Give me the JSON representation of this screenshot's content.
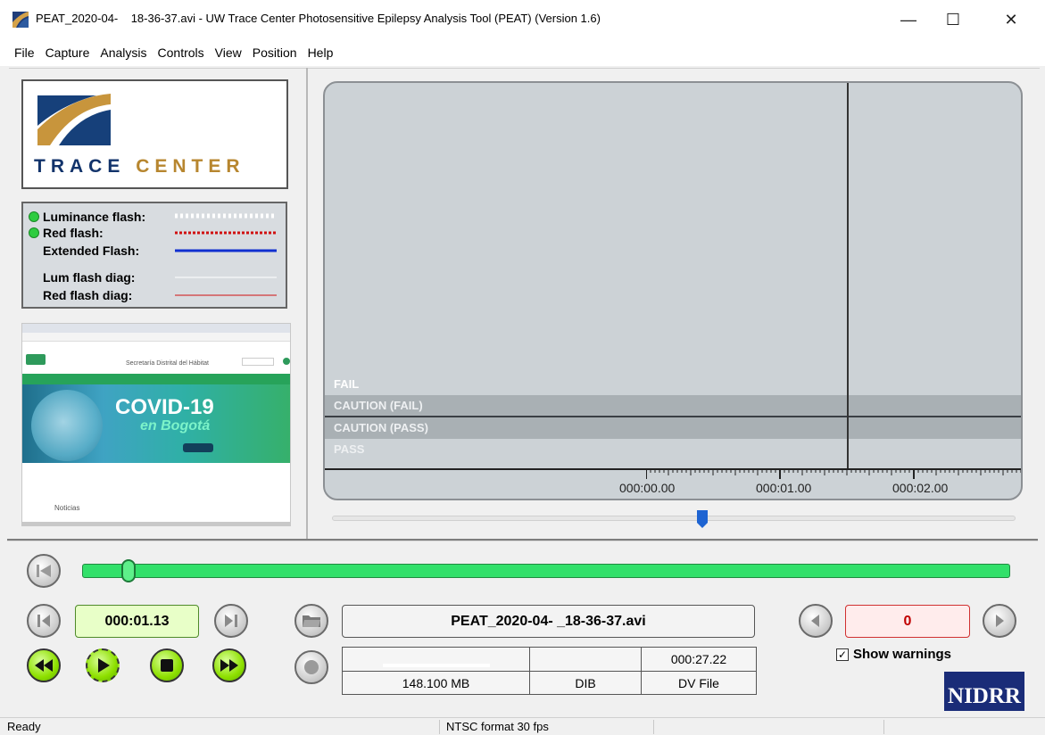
{
  "window": {
    "title": "PEAT_2020-04-    18-36-37.avi - UW Trace Center Photosensitive Epilepsy Analysis Tool (PEAT) (Version 1.6)",
    "minimize": "—",
    "maximize": "☐",
    "close": "✕"
  },
  "menu": [
    "File",
    "Capture",
    "Analysis",
    "Controls",
    "View",
    "Position",
    "Help"
  ],
  "logo": {
    "word1": "TRACE",
    "word2": "CENTER"
  },
  "legend": [
    {
      "label": "Luminance flash:",
      "dot": true,
      "style": "dots-white"
    },
    {
      "label": "Red flash:",
      "dot": true,
      "style": "dots-red"
    },
    {
      "label": "Extended Flash:",
      "dot": false,
      "style": "solid-blue"
    },
    {
      "label": "Lum flash diag:",
      "dot": false,
      "style": "thin-white"
    },
    {
      "label": "Red flash diag:",
      "dot": false,
      "style": "thin-red"
    }
  ],
  "thumbnail": {
    "site_title": "Secretaría Distrital del Hábitat",
    "banner_title": "COVID-19",
    "banner_subtitle": "en Bogotá",
    "footer_text": "Noticias"
  },
  "graph": {
    "bands": [
      "FAIL",
      "CAUTION (FAIL)",
      "CAUTION (PASS)",
      "PASS"
    ],
    "ticks": [
      "000:00.00",
      "000:01.00",
      "000:02.00"
    ]
  },
  "playback": {
    "position_fraction": 0.05,
    "current_time": "000:01.13",
    "file_name": "PEAT_2020-04-     _18-36-37.avi",
    "warning_count": "0",
    "show_warnings_label": "Show warnings",
    "show_warnings_checked": true
  },
  "file_info": {
    "duration": "000:27.22",
    "size": "148.100 MB",
    "format": "DIB",
    "type": "DV File"
  },
  "sponsor": "NIDRR",
  "status": {
    "left": "Ready",
    "middle": "NTSC format  30 fps"
  },
  "colors": {
    "progress": "#32e06a",
    "graph_bg": "#ccd2d6",
    "band_caution": "#a9b0b4",
    "accent_blue": "#1e64d2"
  }
}
